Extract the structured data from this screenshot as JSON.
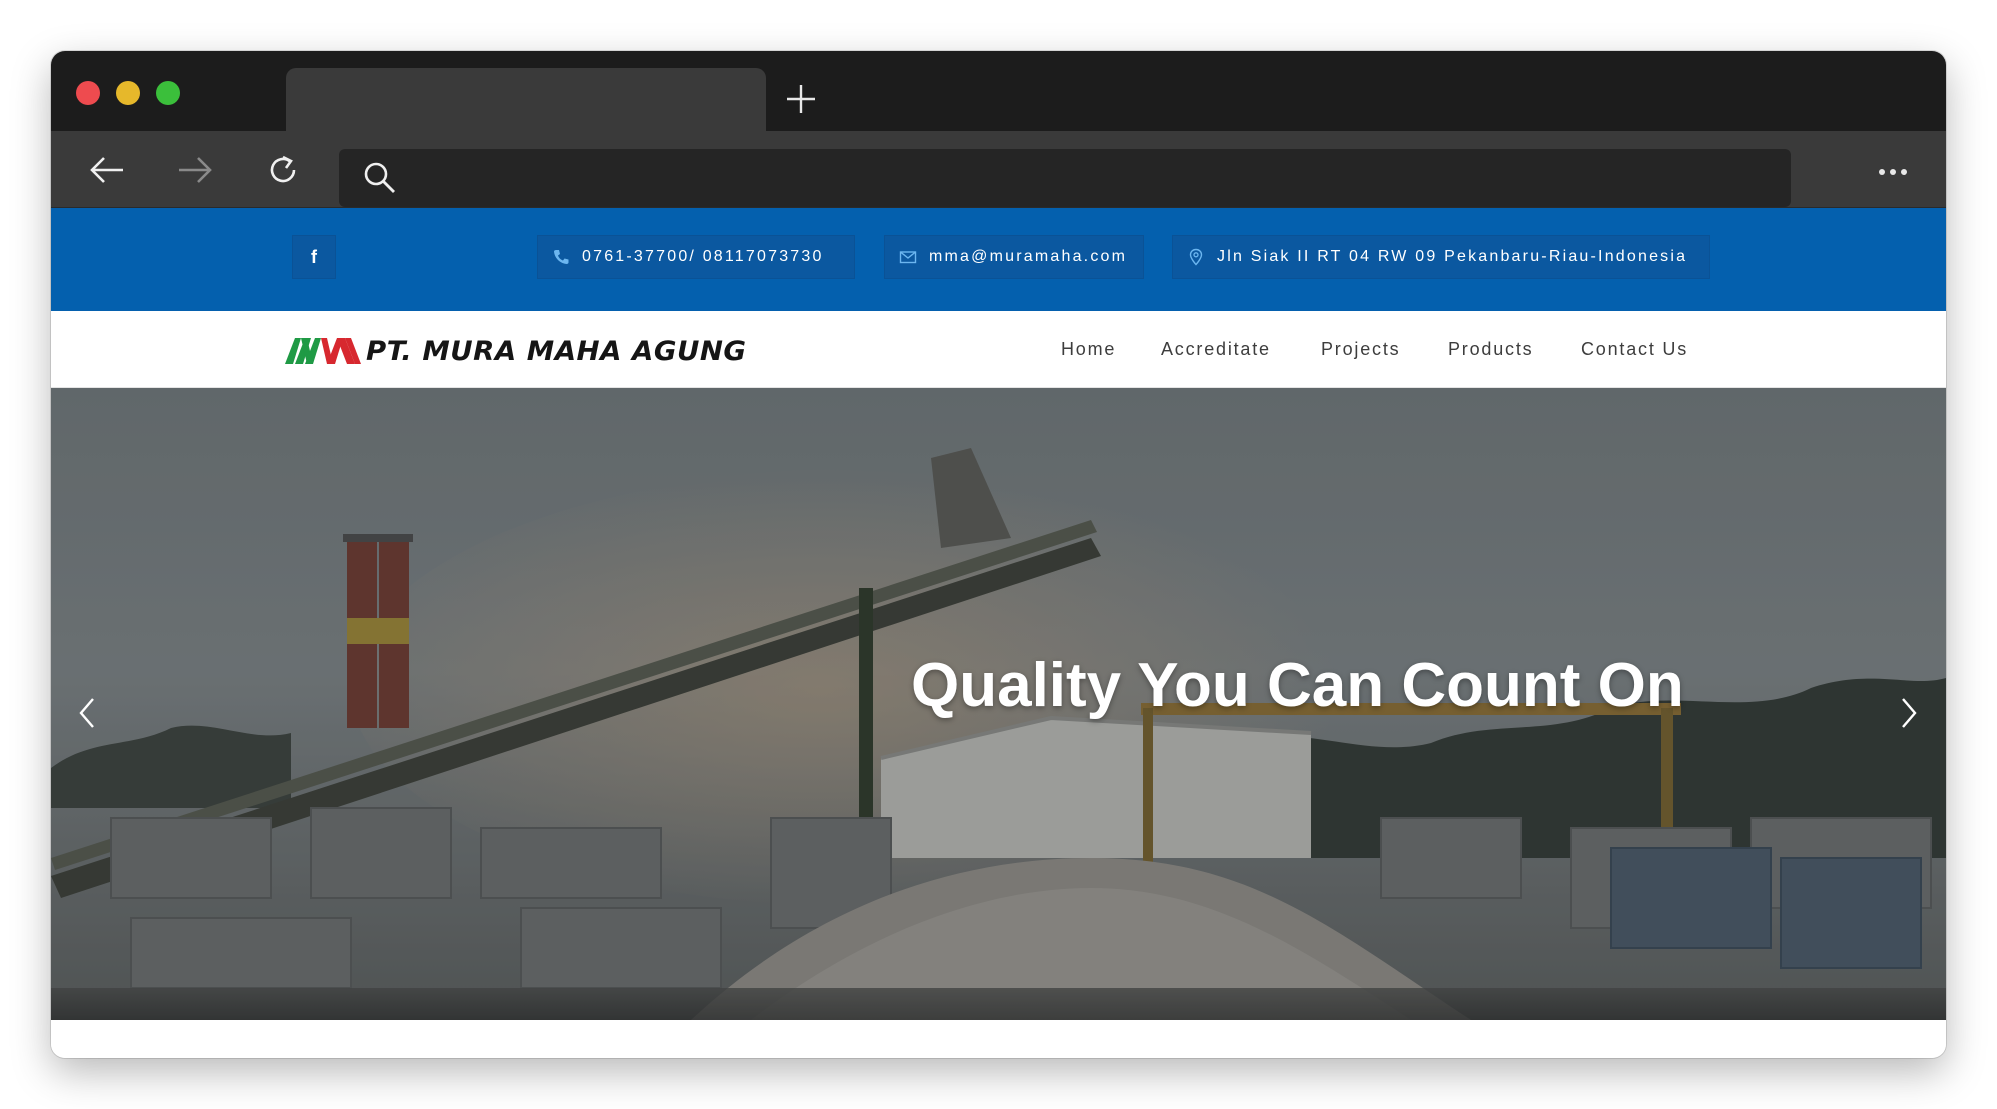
{
  "browser": {
    "tab_title": "",
    "address": "",
    "icons": {
      "back": "arrow-left-icon",
      "forward": "arrow-right-icon",
      "reload": "reload-icon",
      "search": "search-icon",
      "menu": "more-horizontal-icon",
      "new_tab": "plus-icon"
    }
  },
  "topbar": {
    "facebook_label": "f",
    "phone": "0761-37700/ 08117073730",
    "email": "mma@muramaha.com",
    "address": "Jln Siak II RT 04 RW 09 Pekanbaru-Riau-Indonesia",
    "color": "#0460ae"
  },
  "header": {
    "logo_text": "PT. MURA MAHA AGUNG",
    "nav": [
      "Home",
      "Accreditate",
      "Projects",
      "Products",
      "Contact Us"
    ]
  },
  "hero": {
    "title": "Quality You Can Count On"
  },
  "colors": {
    "logo_green": "#1f9a45",
    "logo_red": "#d7282f",
    "accent_blue": "#0460ae"
  }
}
